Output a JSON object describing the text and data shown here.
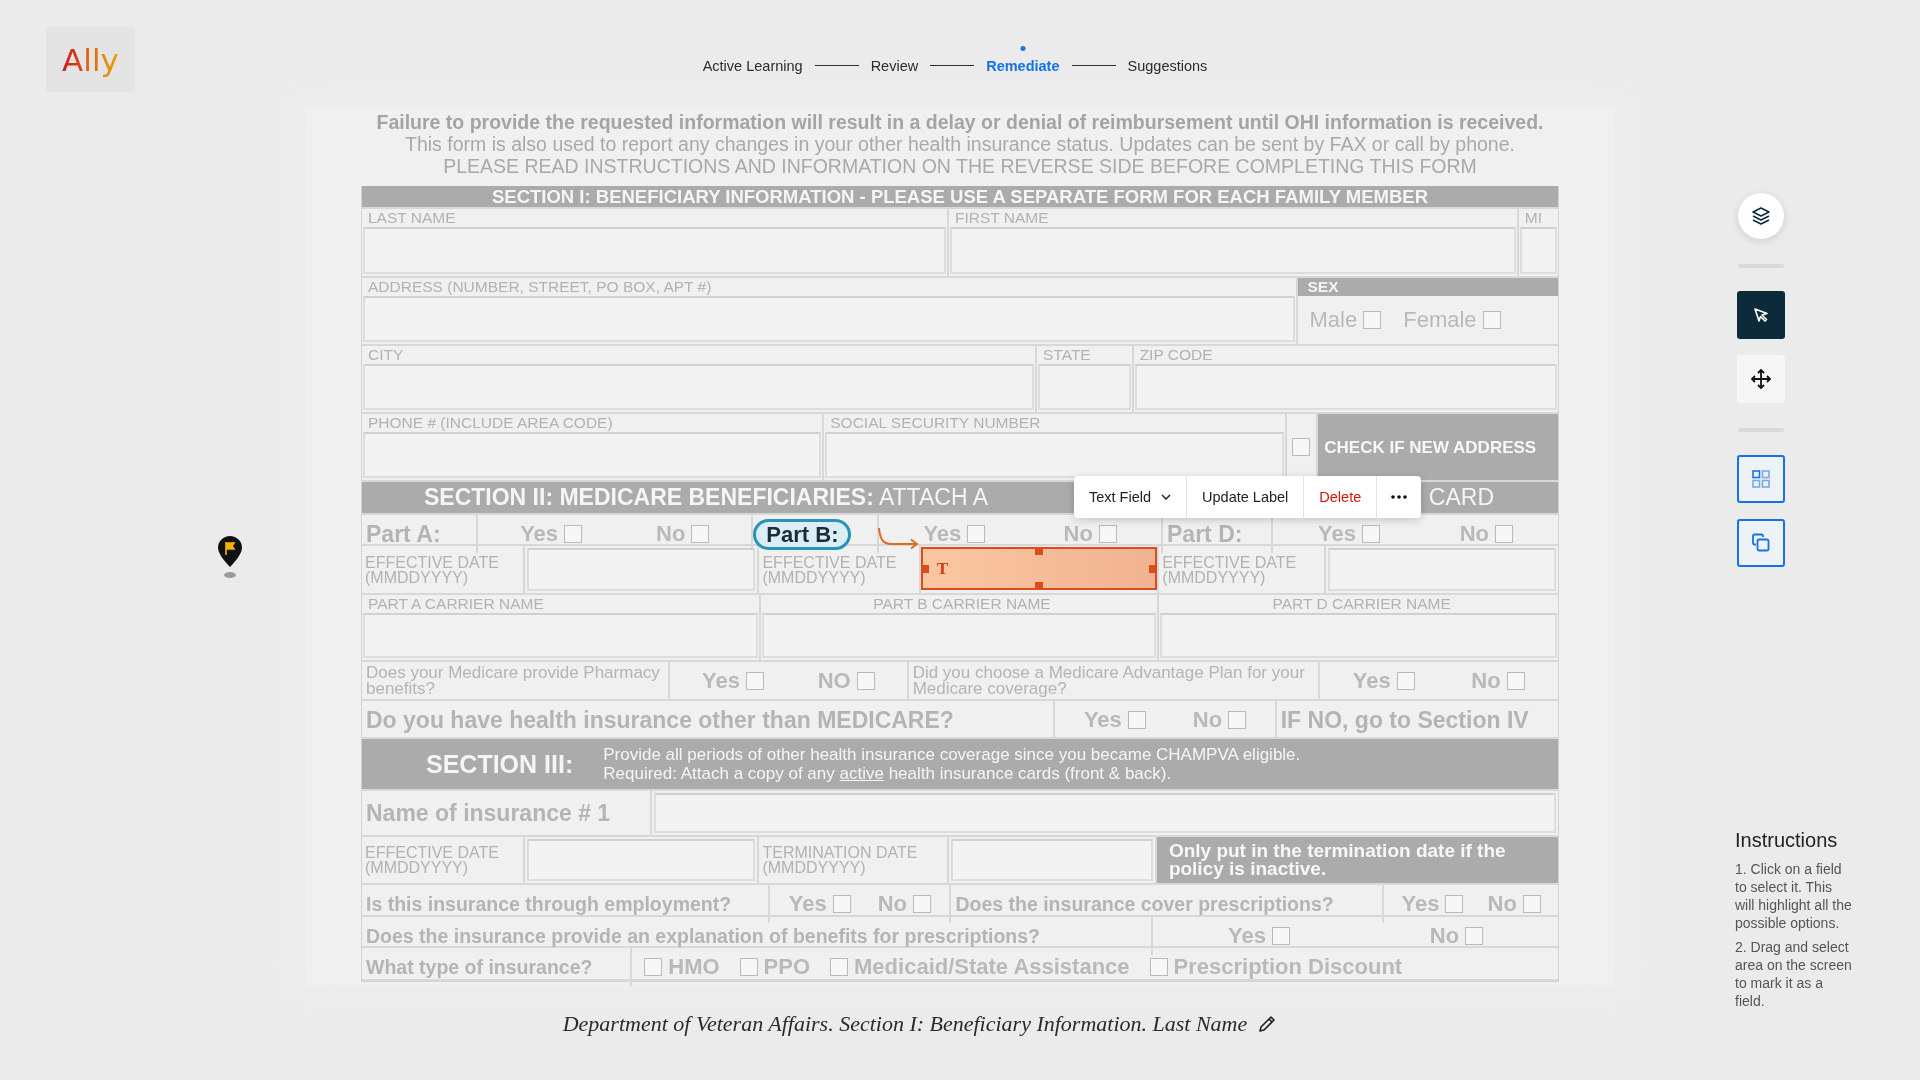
{
  "logo": "Ally",
  "steps": [
    {
      "label": "Active Learning",
      "selected": false
    },
    {
      "label": "Review",
      "selected": false
    },
    {
      "label": "Remediate",
      "selected": true
    },
    {
      "label": "Suggestions",
      "selected": false
    }
  ],
  "form": {
    "notice": [
      {
        "text": "Failure to provide the requested information will result in a delay or denial of reimbursement until OHI information is received.",
        "faded": true
      },
      {
        "text": "This form is also used to report any changes in your other health insurance status. Updates can be sent by FAX or call by phone.",
        "faded": false
      },
      {
        "text": "PLEASE READ INSTRUCTIONS AND INFORMATION ON THE REVERSE SIDE BEFORE COMPLETING THIS FORM",
        "faded": false
      }
    ],
    "rows": [
      {
        "kind": "bar",
        "text": "SECTION I: BENEFICIARY INFORMATION - PLEASE USE A SEPARATE FORM FOR EACH FAMILY MEMBER"
      },
      {
        "kind": "grid",
        "cells": [
          {
            "kind": "labeled",
            "label": "LAST NAME"
          },
          {
            "kind": "labeled",
            "label": "FIRST NAME"
          },
          {
            "kind": "labeled",
            "label": "MI"
          }
        ]
      },
      {
        "kind": "grid",
        "cells": [
          {
            "kind": "labeled",
            "label": "ADDRESS (NUMBER, STREET, PO BOX, APT #)"
          },
          {
            "kind": "choice",
            "label": "SEX",
            "options": [
              {
                "label": "Male",
                "checked": false
              },
              {
                "label": "Female",
                "checked": false
              }
            ]
          }
        ]
      },
      {
        "kind": "grid",
        "cells": [
          {
            "kind": "labeled",
            "label": "CITY"
          },
          {
            "kind": "labeled",
            "label": "STATE"
          },
          {
            "kind": "labeled",
            "label": "ZIP CODE"
          }
        ]
      },
      {
        "kind": "grid",
        "cells": [
          {
            "kind": "labeled",
            "label": "PHONE # (INCLUDE AREA CODE)"
          },
          {
            "kind": "labeled",
            "label": "SOCIAL SECURITY NUMBER"
          },
          {
            "kind": "check",
            "checked": false
          },
          {
            "kind": "note",
            "text": "CHECK IF NEW ADDRESS"
          }
        ]
      },
      {
        "kind": "bar-split",
        "texts": [
          "**SECTION II: MEDICARE BENEFICIARIES:** ATTACH A",
          "CARD"
        ]
      },
      {
        "kind": "grid",
        "cells": [
          {
            "kind": "question-lg",
            "text": "Part A:",
            "highlighted": false
          },
          {
            "kind": "options",
            "options": [
              {
                "label": "Yes",
                "checked": false
              },
              {
                "label": "No",
                "checked": false
              }
            ]
          },
          {
            "kind": "question-lg",
            "text": "Part B:",
            "highlighted": true
          },
          {
            "kind": "options",
            "options": [
              {
                "label": "Yes",
                "checked": false
              },
              {
                "label": "No",
                "checked": false
              }
            ]
          },
          {
            "kind": "question-lg",
            "text": "Part D:",
            "highlighted": false
          },
          {
            "kind": "options",
            "options": [
              {
                "label": "Yes",
                "checked": false
              },
              {
                "label": "No",
                "checked": false
              }
            ]
          }
        ]
      },
      {
        "kind": "grid",
        "cells": [
          {
            "kind": "side-label",
            "text": "EFFECTIVE DATE (MMDDYYYY)"
          },
          {
            "kind": "input",
            "selected": false
          },
          {
            "kind": "side-label",
            "text": "EFFECTIVE DATE (MMDDYYYY)"
          },
          {
            "kind": "input",
            "selected": true,
            "glyph": "T"
          },
          {
            "kind": "side-label",
            "text": "EFFECTIVE DATE (MMDDYYYY)"
          },
          {
            "kind": "input",
            "selected": false
          }
        ]
      },
      {
        "kind": "grid",
        "cells": [
          {
            "kind": "labeled",
            "label": "PART A CARRIER NAME"
          },
          {
            "kind": "labeled-center",
            "label": "PART B CARRIER NAME"
          },
          {
            "kind": "labeled-center",
            "label": "PART D CARRIER NAME"
          }
        ]
      },
      {
        "kind": "grid",
        "cells": [
          {
            "kind": "question-sm",
            "text": "Does your Medicare provide Pharmacy benefits?"
          },
          {
            "kind": "options",
            "options": [
              {
                "label": "Yes",
                "checked": false
              },
              {
                "label": "NO",
                "checked": false
              }
            ]
          },
          {
            "kind": "question-sm",
            "text": "Did you choose a Medicare Advantage Plan for your Medicare coverage?"
          },
          {
            "kind": "options",
            "options": [
              {
                "label": "Yes",
                "checked": false
              },
              {
                "label": "No",
                "checked": false
              }
            ]
          }
        ]
      },
      {
        "kind": "grid",
        "cells": [
          {
            "kind": "question-lg",
            "text": "Do you have health insurance other than MEDICARE?",
            "highlighted": false
          },
          {
            "kind": "options",
            "options": [
              {
                "label": "Yes",
                "checked": false
              },
              {
                "label": "No",
                "checked": false
              }
            ]
          },
          {
            "kind": "question-lg",
            "text": "IF NO, go to Section IV",
            "highlighted": false
          }
        ]
      },
      {
        "kind": "section3",
        "title": "SECTION III:",
        "lines": [
          [
            {
              "text": "Provide all periods of other health insurance coverage since you became CHAMPVA eligible.",
              "underline": false
            }
          ],
          [
            {
              "text": "Required: Attach a copy of any ",
              "underline": false
            },
            {
              "text": "active",
              "underline": true
            },
            {
              "text": " health insurance cards (front & back).",
              "underline": false
            }
          ]
        ]
      },
      {
        "kind": "grid",
        "cells": [
          {
            "kind": "question-lg",
            "text": "Name of insurance # 1",
            "highlighted": false
          },
          {
            "kind": "input",
            "selected": false
          }
        ]
      },
      {
        "kind": "grid",
        "cells": [
          {
            "kind": "side-label",
            "text": "EFFECTIVE DATE (MMDDYYYY)"
          },
          {
            "kind": "input",
            "selected": false
          },
          {
            "kind": "side-label",
            "text": "TERMINATION DATE (MMDDYYYY)"
          },
          {
            "kind": "input",
            "selected": false
          },
          {
            "kind": "note",
            "text": "Only put in the termination date if the policy is inactive."
          }
        ]
      },
      {
        "kind": "grid",
        "cells": [
          {
            "kind": "question",
            "text": "Is this insurance through employment?"
          },
          {
            "kind": "options",
            "options": [
              {
                "label": "Yes",
                "checked": false
              },
              {
                "label": "No",
                "checked": false
              }
            ]
          },
          {
            "kind": "question",
            "text": "Does the insurance cover prescriptions?"
          },
          {
            "kind": "options",
            "options": [
              {
                "label": "Yes",
                "checked": false
              },
              {
                "label": "No",
                "checked": false
              }
            ]
          }
        ]
      },
      {
        "kind": "grid",
        "cells": [
          {
            "kind": "question",
            "text": "Does the insurance provide an explanation of benefits for prescriptions?"
          },
          {
            "kind": "options",
            "options": [
              {
                "label": "Yes",
                "checked": false
              },
              {
                "label": "No",
                "checked": false
              }
            ]
          }
        ]
      },
      {
        "kind": "grid",
        "cells": [
          {
            "kind": "question",
            "text": "What type of insurance?"
          },
          {
            "kind": "options-pre",
            "options": [
              {
                "label": "HMO",
                "checked": false
              },
              {
                "label": "PPO",
                "checked": false
              },
              {
                "label": "Medicaid/State Assistance",
                "checked": false
              },
              {
                "label": "Prescription Discount",
                "checked": false
              }
            ]
          }
        ]
      }
    ]
  },
  "field_toolbar": {
    "type_menu": "Text Field",
    "buttons": [
      {
        "label": "Update Label",
        "kind": "normal"
      },
      {
        "label": "Delete",
        "kind": "danger"
      }
    ]
  },
  "tool_groups": [
    [
      {
        "kind": "layers",
        "selected": false
      }
    ],
    [
      {
        "kind": "pointer",
        "selected": true
      },
      {
        "kind": "move",
        "selected": false
      }
    ],
    [
      {
        "kind": "grid",
        "selected": false
      },
      {
        "kind": "copy",
        "selected": false
      }
    ]
  ],
  "instructions": {
    "title": "Instructions",
    "steps": [
      "1. Click on a field to select it. This will highlight all the possible options.",
      "2. Drag and select area on the screen to mark it as a field."
    ]
  },
  "caption": "Department of Veteran Affairs. Section I: Beneficiary Information. Last Name"
}
